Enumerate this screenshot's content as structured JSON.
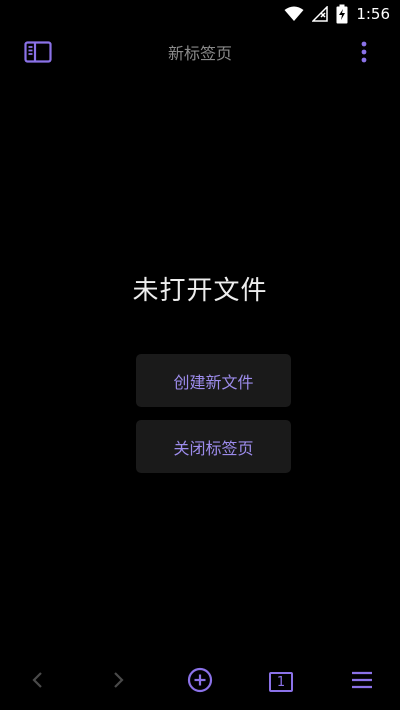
{
  "status_bar": {
    "time": "1:56",
    "icons": [
      "wifi-icon",
      "signal-icon",
      "battery-charging-icon"
    ]
  },
  "app_bar": {
    "title": "新标签页",
    "left_icon": "sidebar-icon",
    "right_icon": "more-vert-icon"
  },
  "main": {
    "empty_title": "未打开文件",
    "create_label": "创建新文件",
    "close_label": "关闭标签页"
  },
  "bottom_bar": {
    "icons": [
      "back-icon",
      "forward-icon",
      "add-circle-icon",
      "tabs-icon",
      "hamburger-icon"
    ],
    "tab_count": "1"
  },
  "colors": {
    "background": "#000000",
    "accent": "#8b72e8",
    "button_bg": "#1a1a1a",
    "button_text": "#9d8cec",
    "title_text": "#8a8a8a",
    "disabled_icon": "#4a4a4a"
  }
}
